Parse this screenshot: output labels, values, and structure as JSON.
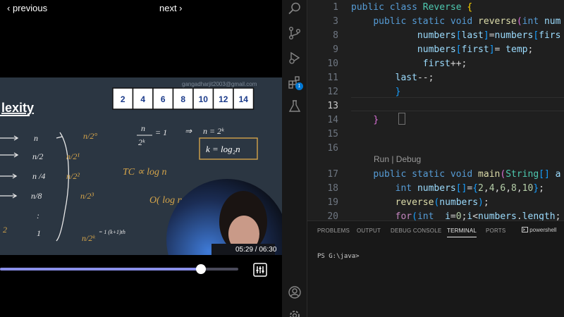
{
  "video": {
    "prev_label": "‹ previous",
    "next_label": "next ›",
    "timecode": "05:29 / 06:30",
    "progress_fraction": 0.842,
    "slide": {
      "title_fragment": "lexity",
      "watermark": "gangadharjit2003@gmail.com",
      "array": [
        "2",
        "4",
        "6",
        "8",
        "10",
        "12",
        "14"
      ]
    }
  },
  "editor": {
    "lines": [
      {
        "n": "1",
        "html": "<span class='kw'>public</span> <span class='kw'>class</span> <span class='cls'>Reverse</span> <span class='br1'>{</span>"
      },
      {
        "n": "3",
        "html": "    <span class='kw'>public</span> <span class='kw'>static</span> <span class='kw'>void</span> <span class='fn'>reverse</span><span class='br2'>(</span><span class='kw'>int</span> <span class='var'>num</span>"
      },
      {
        "n": "8",
        "html": "            <span class='var'>numbers</span><span class='br3'>[</span><span class='var'>last</span><span class='br3'>]</span>=<span class='var'>numbers</span><span class='br3'>[</span><span class='var'>firs</span>"
      },
      {
        "n": "9",
        "html": "            <span class='var'>numbers</span><span class='br3'>[</span><span class='var'>first</span><span class='br3'>]</span>= <span class='var'>temp</span>;"
      },
      {
        "n": "10",
        "html": "             <span class='var'>first</span>++;"
      },
      {
        "n": "11",
        "html": "        <span class='var'>last</span>--;"
      },
      {
        "n": "12",
        "html": "        <span class='br3'>}</span>"
      },
      {
        "n": "13",
        "html": ""
      },
      {
        "n": "14",
        "html": "    <span class='br2'>}</span>"
      },
      {
        "n": "15",
        "html": ""
      },
      {
        "n": "16",
        "html": ""
      },
      {
        "n": "17",
        "html": "    <span class='kw'>public</span> <span class='kw'>static</span> <span class='kw'>void</span> <span class='fn'>main</span><span class='br2'>(</span><span class='cls'>String</span><span class='br3'>[]</span> <span class='var'>a</span>"
      },
      {
        "n": "18",
        "html": "        <span class='kw'>int</span> <span class='var'>numbers</span><span class='br3'>[]</span>=<span class='br3'>{</span><span class='num'>2</span>,<span class='num'>4</span>,<span class='num'>6</span>,<span class='num'>8</span>,<span class='num'>10</span><span class='br3'>}</span>;"
      },
      {
        "n": "19",
        "html": "        <span class='fn'>reverse</span><span class='br3'>(</span><span class='var'>numbers</span><span class='br3'>)</span>;"
      },
      {
        "n": "20",
        "html": "        <span class='ctl'>for</span><span class='br3'>(</span><span class='kw'>int</span>  <span class='var'>i</span>=<span class='num'>0</span>;<span class='var'>i</span>&lt;<span class='var'>numbers</span>.<span class='var'>length</span>;"
      }
    ],
    "active_line": "13",
    "codelens": "Run | Debug"
  },
  "activity": {
    "extensions_badge": "1"
  },
  "panel": {
    "tabs": [
      "PROBLEMS",
      "OUTPUT",
      "DEBUG CONSOLE",
      "TERMINAL",
      "PORTS"
    ],
    "active_tab": "TERMINAL",
    "shell": "powershell",
    "prompt": "PS G:\\java>"
  }
}
